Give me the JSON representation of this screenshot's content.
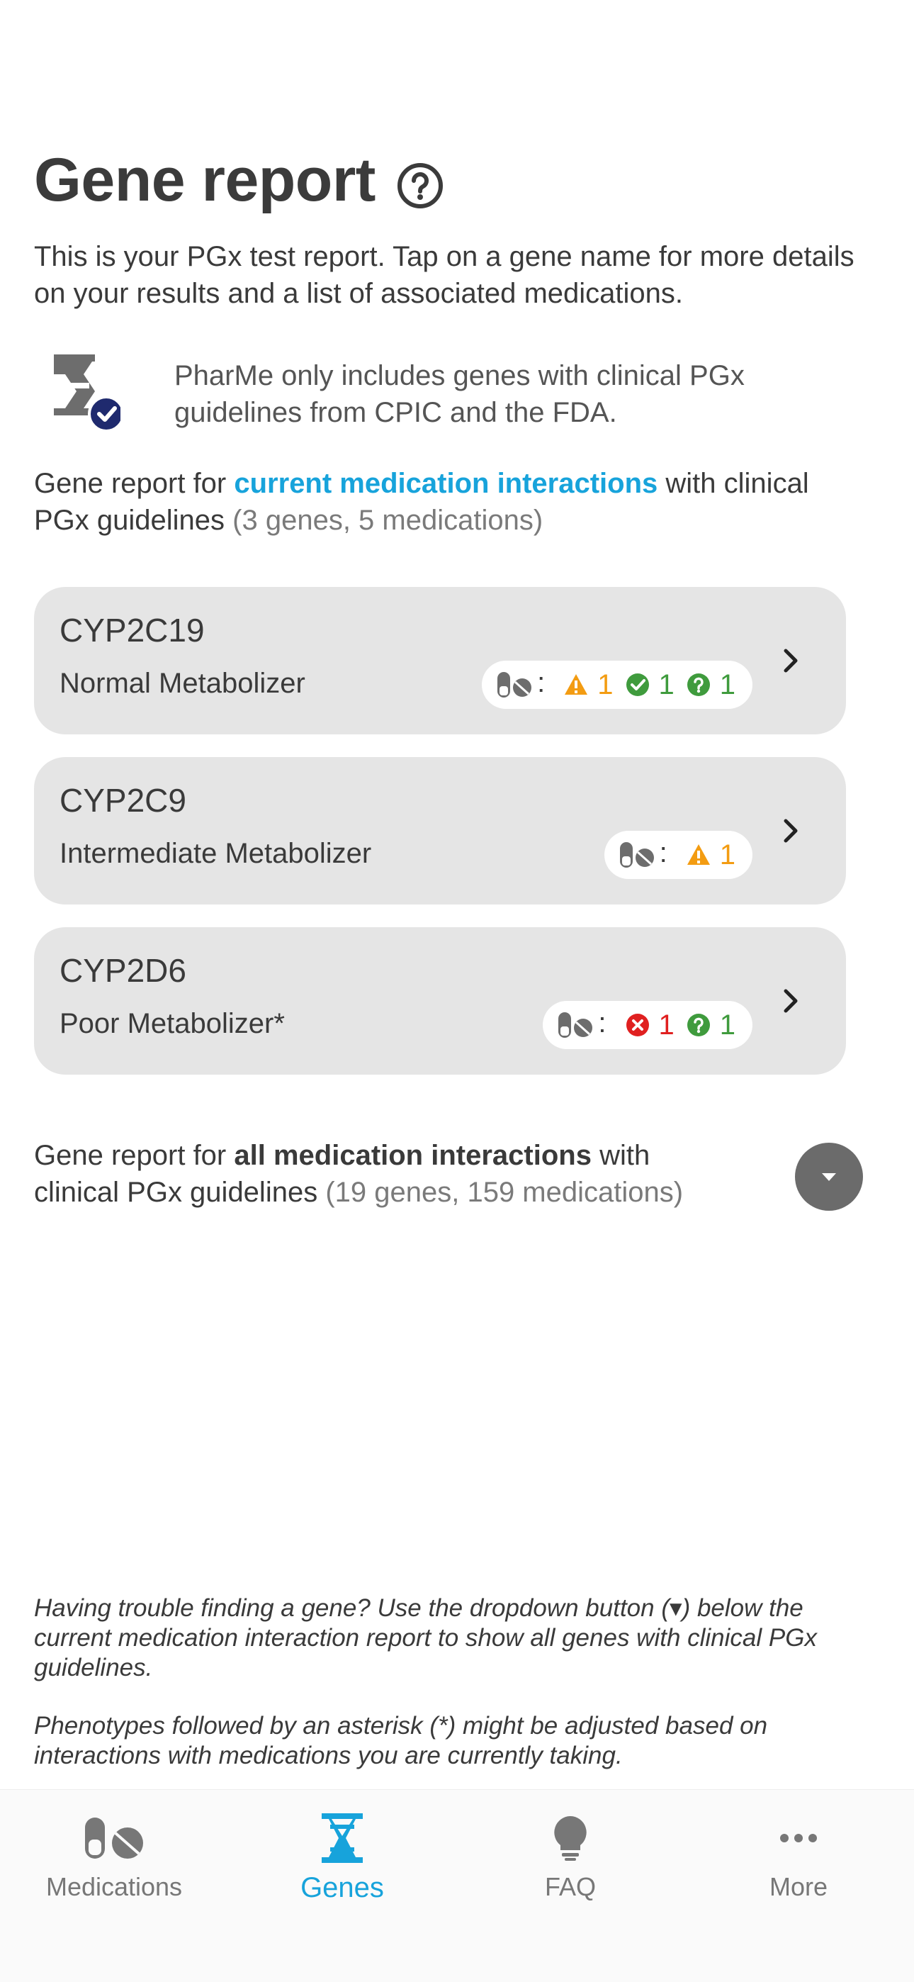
{
  "header": {
    "title": "Gene report",
    "help_icon": "help-circle-icon"
  },
  "intro": "This is your PGx test report. Tap on a gene name for more details on your results and a list of associated medications.",
  "note": {
    "icon": "dna-check-icon",
    "text": "PharMe only includes genes with clinical PGx guidelines from CPIC and the FDA."
  },
  "current_section": {
    "prefix": "Gene report for ",
    "highlight": "current medication interactions",
    "suffix": " with clinical PGx guidelines ",
    "counts": "(3 genes, 5 medications)"
  },
  "genes": [
    {
      "name": "CYP2C19",
      "phenotype": "Normal Metabolizer",
      "colon": ":",
      "warning_count": "1",
      "ok_count": "1",
      "unknown_count": "1"
    },
    {
      "name": "CYP2C9",
      "phenotype": "Intermediate Metabolizer",
      "colon": ":",
      "warning_count": "1"
    },
    {
      "name": "CYP2D6",
      "phenotype": "Poor Metabolizer*",
      "colon": ":",
      "bad_count": "1",
      "unknown_count": "1"
    }
  ],
  "all_section": {
    "prefix": "Gene report for ",
    "strong": "all medication interactions",
    "suffix": " with clinical PGx guidelines ",
    "counts": "(19 genes, 159 medications)",
    "dropdown_icon": "chevron-down-icon"
  },
  "footnotes": {
    "first": "Having trouble finding a gene? Use the dropdown button (▾) below the current medication interaction report to show all genes with clinical PGx guidelines.",
    "second": "Phenotypes followed by an asterisk (*) might be adjusted based on interactions with medications you are currently taking."
  },
  "tabs": [
    {
      "label": "Medications",
      "icon": "pills-icon",
      "active": false
    },
    {
      "label": "Genes",
      "icon": "dna-icon",
      "active": true
    },
    {
      "label": "FAQ",
      "icon": "lightbulb-icon",
      "active": false
    },
    {
      "label": "More",
      "icon": "more-dots-icon",
      "active": false
    }
  ],
  "colors": {
    "accent": "#17a3db",
    "warning": "#f39c12",
    "ok": "#3f9b3d",
    "bad": "#e02020",
    "card_bg": "#e5e5e5",
    "check_badge": "#1f2a6e"
  }
}
